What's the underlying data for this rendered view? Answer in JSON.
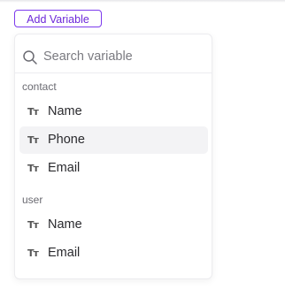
{
  "toolbar": {
    "add_variable_label": "Add Variable"
  },
  "search": {
    "placeholder": "Search variable",
    "icon": "search-icon"
  },
  "groups": [
    {
      "label": "contact",
      "items": [
        {
          "label": "Name",
          "icon": "text-type-icon",
          "icon_glyph": "Tт"
        },
        {
          "label": "Phone",
          "icon": "text-type-icon",
          "icon_glyph": "Tт",
          "hovered": true
        },
        {
          "label": "Email",
          "icon": "text-type-icon",
          "icon_glyph": "Tт"
        }
      ]
    },
    {
      "label": "user",
      "items": [
        {
          "label": "Name",
          "icon": "text-type-icon",
          "icon_glyph": "Tт"
        },
        {
          "label": "Email",
          "icon": "text-type-icon",
          "icon_glyph": "Tт"
        }
      ]
    }
  ],
  "colors": {
    "accent": "#7c3aed",
    "hover_bg": "#f3f3f5"
  }
}
